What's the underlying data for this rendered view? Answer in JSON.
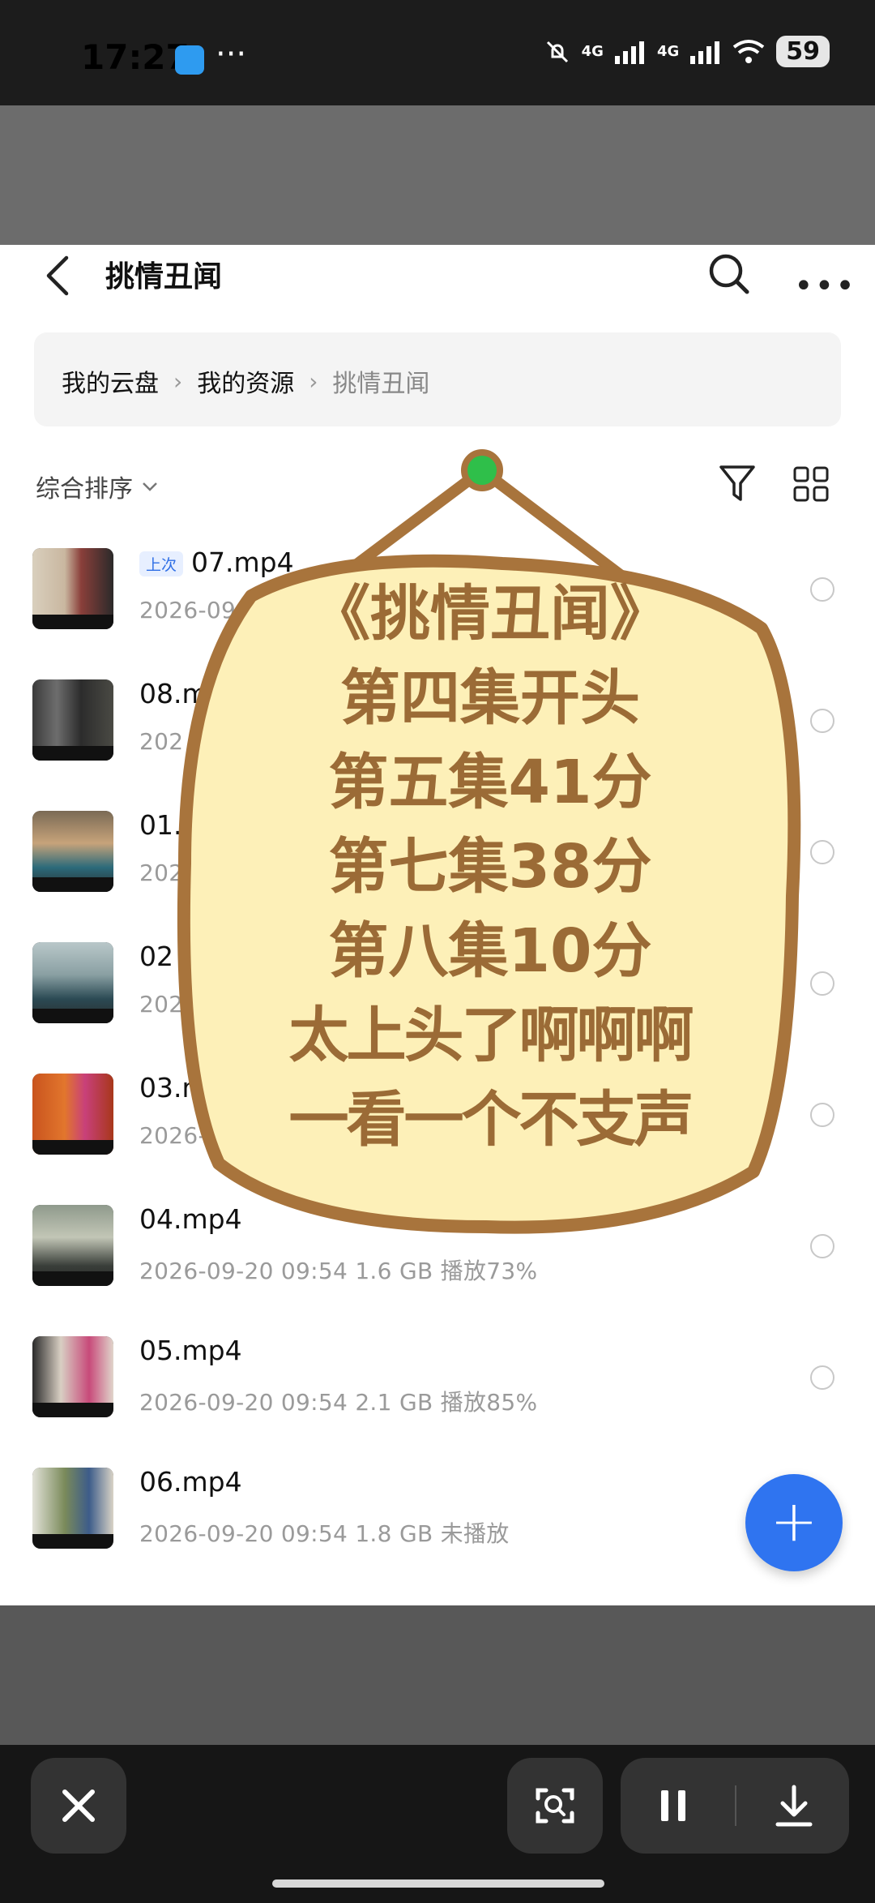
{
  "status": {
    "time": "17:27",
    "battery": "59",
    "net1": "4G",
    "net2": "4G"
  },
  "header": {
    "title": "挑情丑闻"
  },
  "breadcrumb": {
    "items": [
      "我的云盘",
      "我的资源",
      "挑情丑闻"
    ],
    "separator": "›"
  },
  "sort": {
    "label": "综合排序"
  },
  "files": [
    {
      "name": "07.mp4",
      "badge": "上次",
      "meta": "2026-09-"
    },
    {
      "name": "08.m",
      "meta": "202"
    },
    {
      "name": "01.",
      "meta": "202"
    },
    {
      "name": "02",
      "meta": "202"
    },
    {
      "name": "03.n",
      "meta": "2026-"
    },
    {
      "name": "04.mp4",
      "meta": "2026-09-20 09:54  1.6 GB  播放73%"
    },
    {
      "name": "05.mp4",
      "meta": "2026-09-20 09:54  2.1 GB  播放85%"
    },
    {
      "name": "06.mp4",
      "meta": "2026-09-20 09:54  1.8 GB  未播放"
    }
  ],
  "fab": {
    "label": "+"
  },
  "sticker": {
    "lines": [
      "《挑情丑闻》",
      "第四集开头",
      "第五集41分",
      "第七集38分",
      "第八集10分",
      "太上头了啊啊啊",
      "一看一个不支声"
    ]
  },
  "colors": {
    "accent": "#2f74f0",
    "sticker_fill": "#fdf0b8",
    "sticker_border": "#a8743c",
    "pin": "#2fbf4a"
  }
}
